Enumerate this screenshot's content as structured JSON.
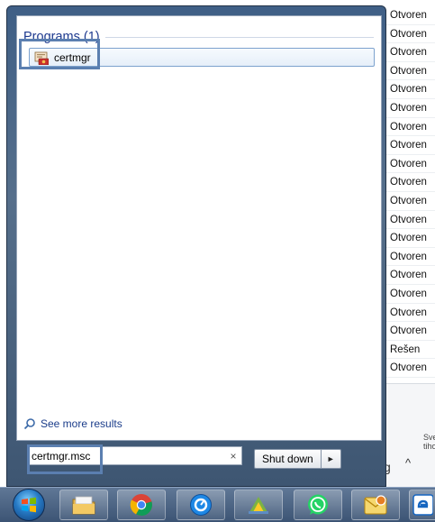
{
  "background": {
    "status_column": [
      "Otvoren",
      "Otvoren",
      "Otvoren",
      "Otvoren",
      "Otvoren",
      "Otvoren",
      "Otvoren",
      "Otvoren",
      "Otvoren",
      "Otvoren",
      "Otvoren",
      "Otvoren",
      "Otvoren",
      "Otvoren",
      "Otvoren",
      "Otvoren",
      "Otvoren",
      "Otvoren",
      "Rešen",
      "Otvoren"
    ],
    "right_fragment": "Sve tiho",
    "right_fragment_g": "g",
    "up_arrow": "^"
  },
  "start_menu": {
    "programs_header": "Programs (1)",
    "results": [
      {
        "label": "certmgr",
        "icon": "certificate-manager-icon"
      }
    ],
    "see_more": "See more results",
    "search": {
      "value": "certmgr.msc",
      "clear": "×"
    },
    "shutdown": {
      "label": "Shut down",
      "arrow": "►"
    }
  },
  "taskbar": {
    "items": [
      "start-orb",
      "file-explorer-icon",
      "chrome-icon",
      "app-blue-icon",
      "windows-app-icon",
      "whatsapp-icon",
      "outlook-icon",
      "edge-icon"
    ]
  },
  "colors": {
    "accent": "#1e3a8f",
    "highlight": "#5b7fb0",
    "taskbar": "#4b6280"
  }
}
